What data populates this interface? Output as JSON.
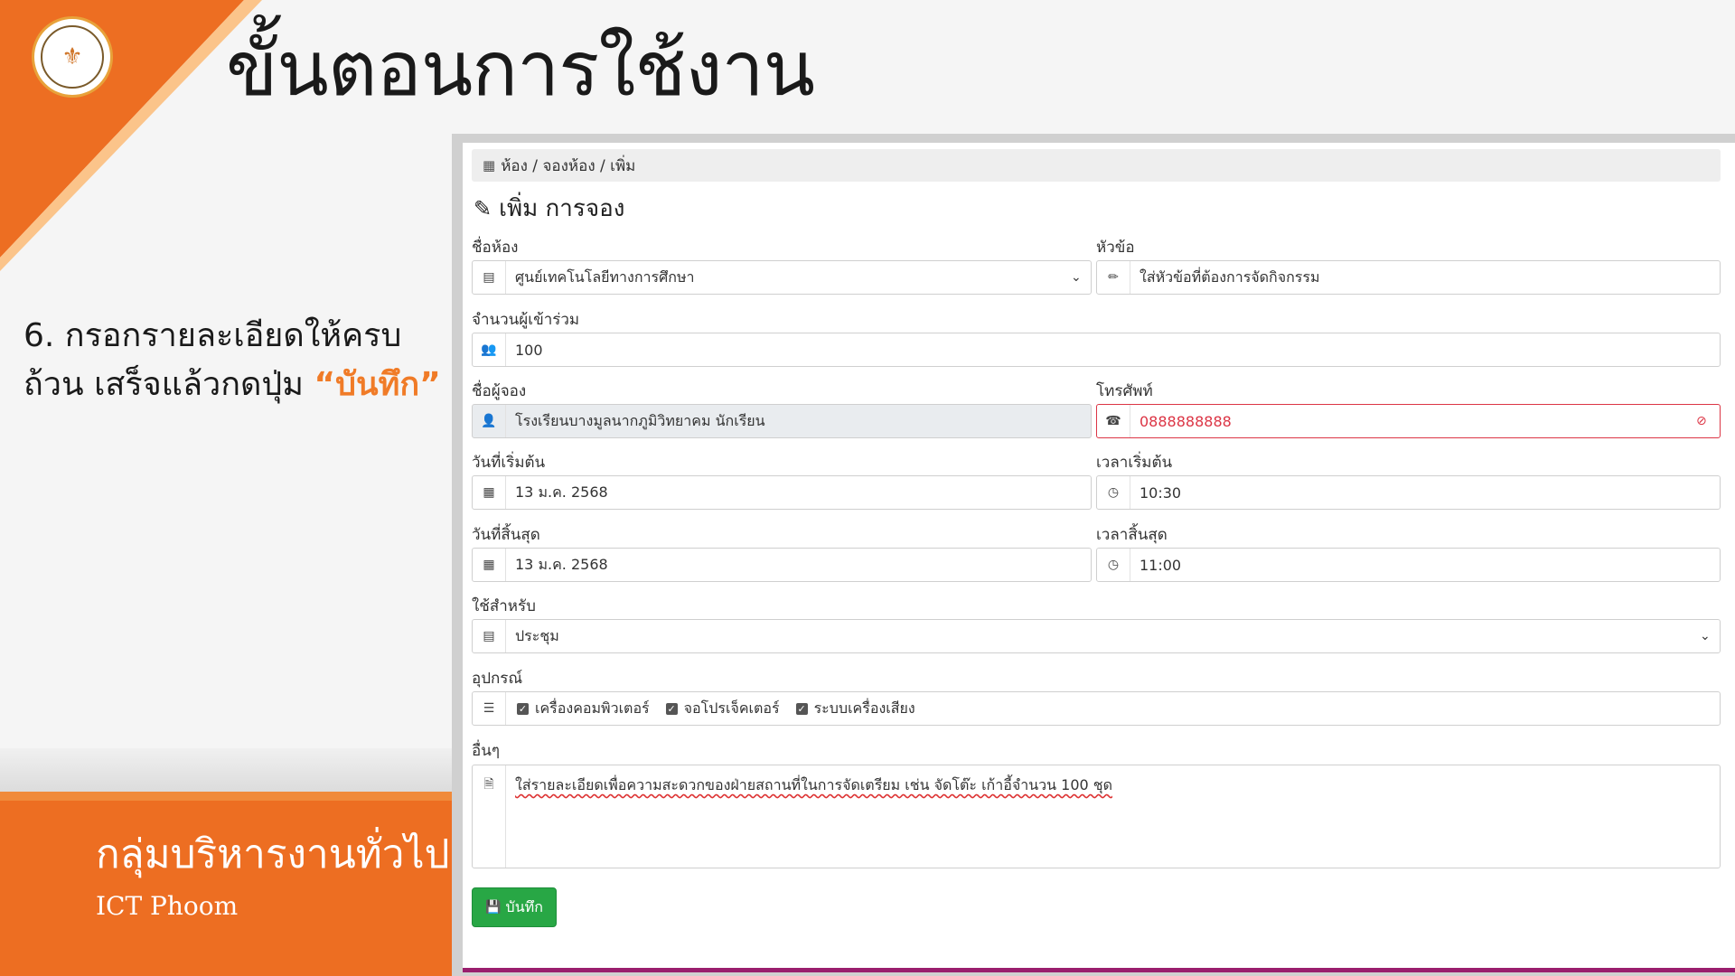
{
  "slide": {
    "title": "ขั้นตอนการใช้งาน",
    "step_text": "6. กรอกรายละเอียดให้ครบถ้วน เสร็จแล้วกดปุ่ม",
    "step_highlight": "“บันทึก”",
    "department": "กลุ่มบริหารงานทั่วไป",
    "organization": "ICT Phoom",
    "accent_color": "#ed6e22"
  },
  "form": {
    "breadcrumb": "ห้อง / จองห้อง / เพิ่ม",
    "title": "เพิ่ม การจอง",
    "room_label": "ชื่อห้อง",
    "room_value": "ศูนย์เทคโนโลยีทางการศึกษา",
    "topic_label": "หัวข้อ",
    "topic_placeholder": "ใส่หัวข้อที่ต้องการจัดกิจกรรม",
    "attendees_label": "จำนวนผู้เข้าร่วม",
    "attendees_value": "100",
    "booker_label": "ชื่อผู้จอง",
    "booker_value": "โรงเรียนบางมูลนากภูมิวิทยาคม นักเรียน",
    "phone_label": "โทรศัพท์",
    "phone_value": "0888888888",
    "start_date_label": "วันที่เริ่มต้น",
    "start_date_value": "13 ม.ค. 2568",
    "start_time_label": "เวลาเริ่มต้น",
    "start_time_value": "10:30",
    "end_date_label": "วันที่สิ้นสุด",
    "end_date_value": "13 ม.ค. 2568",
    "end_time_label": "เวลาสิ้นสุด",
    "end_time_value": "11:00",
    "usage_label": "ใช้สำหรับ",
    "usage_value": "ประชุม",
    "equipment_label": "อุปกรณ์",
    "equipment": [
      "เครื่องคอมพิวเตอร์",
      "จอโปรเจ็คเตอร์",
      "ระบบเครื่องเสียง"
    ],
    "other_label": "อื่นๆ",
    "other_value": "ใส่รายละเอียดเพื่อความสะดวกของฝ่ายสถานที่ในการจัดเตรียม เช่น จัดโต๊ะ เก้าอี้จำนวน 100 ชุด",
    "save_label": "บันทึก",
    "save_color": "#28a745",
    "error_color": "#dc3545"
  }
}
